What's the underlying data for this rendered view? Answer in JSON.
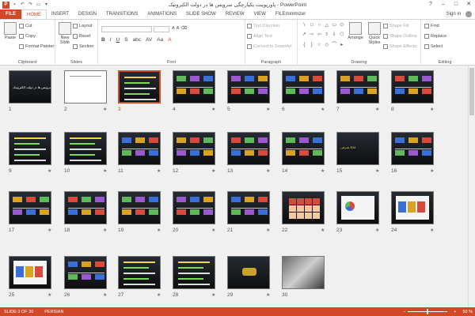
{
  "titlebar": {
    "title": "پاورپوینت یکپارچگی سرویس ها در دولت الکترونیک - PowerPoint",
    "app_icon": "P",
    "qat_icons": [
      "save-icon",
      "undo-icon",
      "redo-icon",
      "present-icon",
      "customize-icon"
    ],
    "help": "?",
    "minimize": "–",
    "maximize": "□",
    "close": "✕"
  },
  "tabs": [
    "FILE",
    "HOME",
    "INSERT",
    "DESIGN",
    "TRANSITIONS",
    "ANIMATIONS",
    "SLIDE SHOW",
    "REVIEW",
    "VIEW",
    "FILEminimizer"
  ],
  "active_tab": "HOME",
  "signin": "Sign in",
  "ribbon": {
    "clipboard": {
      "paste": "Paste",
      "cut": "Cut",
      "copy": "Copy",
      "format_painter": "Format Painter",
      "label": "Clipboard"
    },
    "slides": {
      "new_slide": "New Slide",
      "layout": "Layout",
      "reset": "Reset",
      "section": "Section",
      "label": "Slides"
    },
    "font": {
      "bold": "B",
      "italic": "I",
      "underline": "U",
      "strike": "S",
      "shadow": "abc",
      "spacing": "AV",
      "case": "Aa",
      "color": "A",
      "label": "Font"
    },
    "paragraph": {
      "text_direction": "Text Direction",
      "align_text": "Align Text",
      "convert": "Convert to SmartArt",
      "label": "Paragraph"
    },
    "drawing": {
      "shapes": [
        "\\",
        "□",
        "○",
        "△",
        "▭",
        "⬭",
        "↗",
        "⇨",
        "⇦",
        "⇧",
        "⇩",
        "⬡",
        "{",
        "}",
        "☆",
        "◇",
        "⌒",
        "▸"
      ],
      "arrange": "Arrange",
      "quick_styles": "Quick Styles",
      "shape_fill": "Shape Fill",
      "shape_outline": "Shape Outline",
      "shape_effects": "Shape Effects",
      "label": "Drawing"
    },
    "editing": {
      "find": "Find",
      "replace": "Replace",
      "select": "Select",
      "label": "Editing"
    }
  },
  "slides": [
    {
      "n": "1",
      "star": false,
      "type": "title",
      "text": "یکپارچگی سرویس ها در دولت الکترونیک"
    },
    {
      "n": "2",
      "star": true,
      "type": "white",
      "text": ""
    },
    {
      "n": "3",
      "star": false,
      "type": "text",
      "text": "",
      "selected": true
    },
    {
      "n": "4",
      "star": true,
      "type": "diagram",
      "text": ""
    },
    {
      "n": "5",
      "star": true,
      "type": "diagram",
      "text": ""
    },
    {
      "n": "6",
      "star": true,
      "type": "diagram",
      "text": ""
    },
    {
      "n": "7",
      "star": true,
      "type": "diagram",
      "text": ""
    },
    {
      "n": "8",
      "star": true,
      "type": "diagram",
      "text": ""
    },
    {
      "n": "9",
      "star": true,
      "type": "text",
      "text": ""
    },
    {
      "n": "10",
      "star": true,
      "type": "text",
      "text": ""
    },
    {
      "n": "11",
      "star": true,
      "type": "diagram",
      "text": ""
    },
    {
      "n": "12",
      "star": true,
      "type": "diagram",
      "text": ""
    },
    {
      "n": "13",
      "star": true,
      "type": "diagram",
      "text": ""
    },
    {
      "n": "14",
      "star": true,
      "type": "diagram",
      "text": ""
    },
    {
      "n": "15",
      "star": true,
      "type": "heading",
      "text": "معرفی EAI"
    },
    {
      "n": "16",
      "star": true,
      "type": "diagram",
      "text": ""
    },
    {
      "n": "17",
      "star": true,
      "type": "diagram",
      "text": ""
    },
    {
      "n": "18",
      "star": true,
      "type": "diagram",
      "text": ""
    },
    {
      "n": "19",
      "star": true,
      "type": "diagram",
      "text": ""
    },
    {
      "n": "20",
      "star": true,
      "type": "diagram",
      "text": ""
    },
    {
      "n": "21",
      "star": true,
      "type": "diagram",
      "text": ""
    },
    {
      "n": "22",
      "star": true,
      "type": "table",
      "text": ""
    },
    {
      "n": "23",
      "star": true,
      "type": "chart",
      "text": ""
    },
    {
      "n": "24",
      "star": true,
      "type": "screen",
      "text": ""
    },
    {
      "n": "25",
      "star": true,
      "type": "screen",
      "text": ""
    },
    {
      "n": "26",
      "star": true,
      "type": "diagram",
      "text": ""
    },
    {
      "n": "27",
      "star": true,
      "type": "text",
      "text": ""
    },
    {
      "n": "28",
      "star": true,
      "type": "text",
      "text": ""
    },
    {
      "n": "29",
      "star": true,
      "type": "end",
      "text": ""
    },
    {
      "n": "30",
      "star": false,
      "type": "photo",
      "text": ""
    }
  ],
  "status": {
    "slide_info": "SLIDE 3 OF 30",
    "language": "PERSIAN",
    "zoom": "50 %",
    "zoom_fraction": 0.5
  },
  "colors": {
    "accent": "#d24726",
    "slide_bg": "#1a1c20",
    "text_green": "#7ed957"
  }
}
